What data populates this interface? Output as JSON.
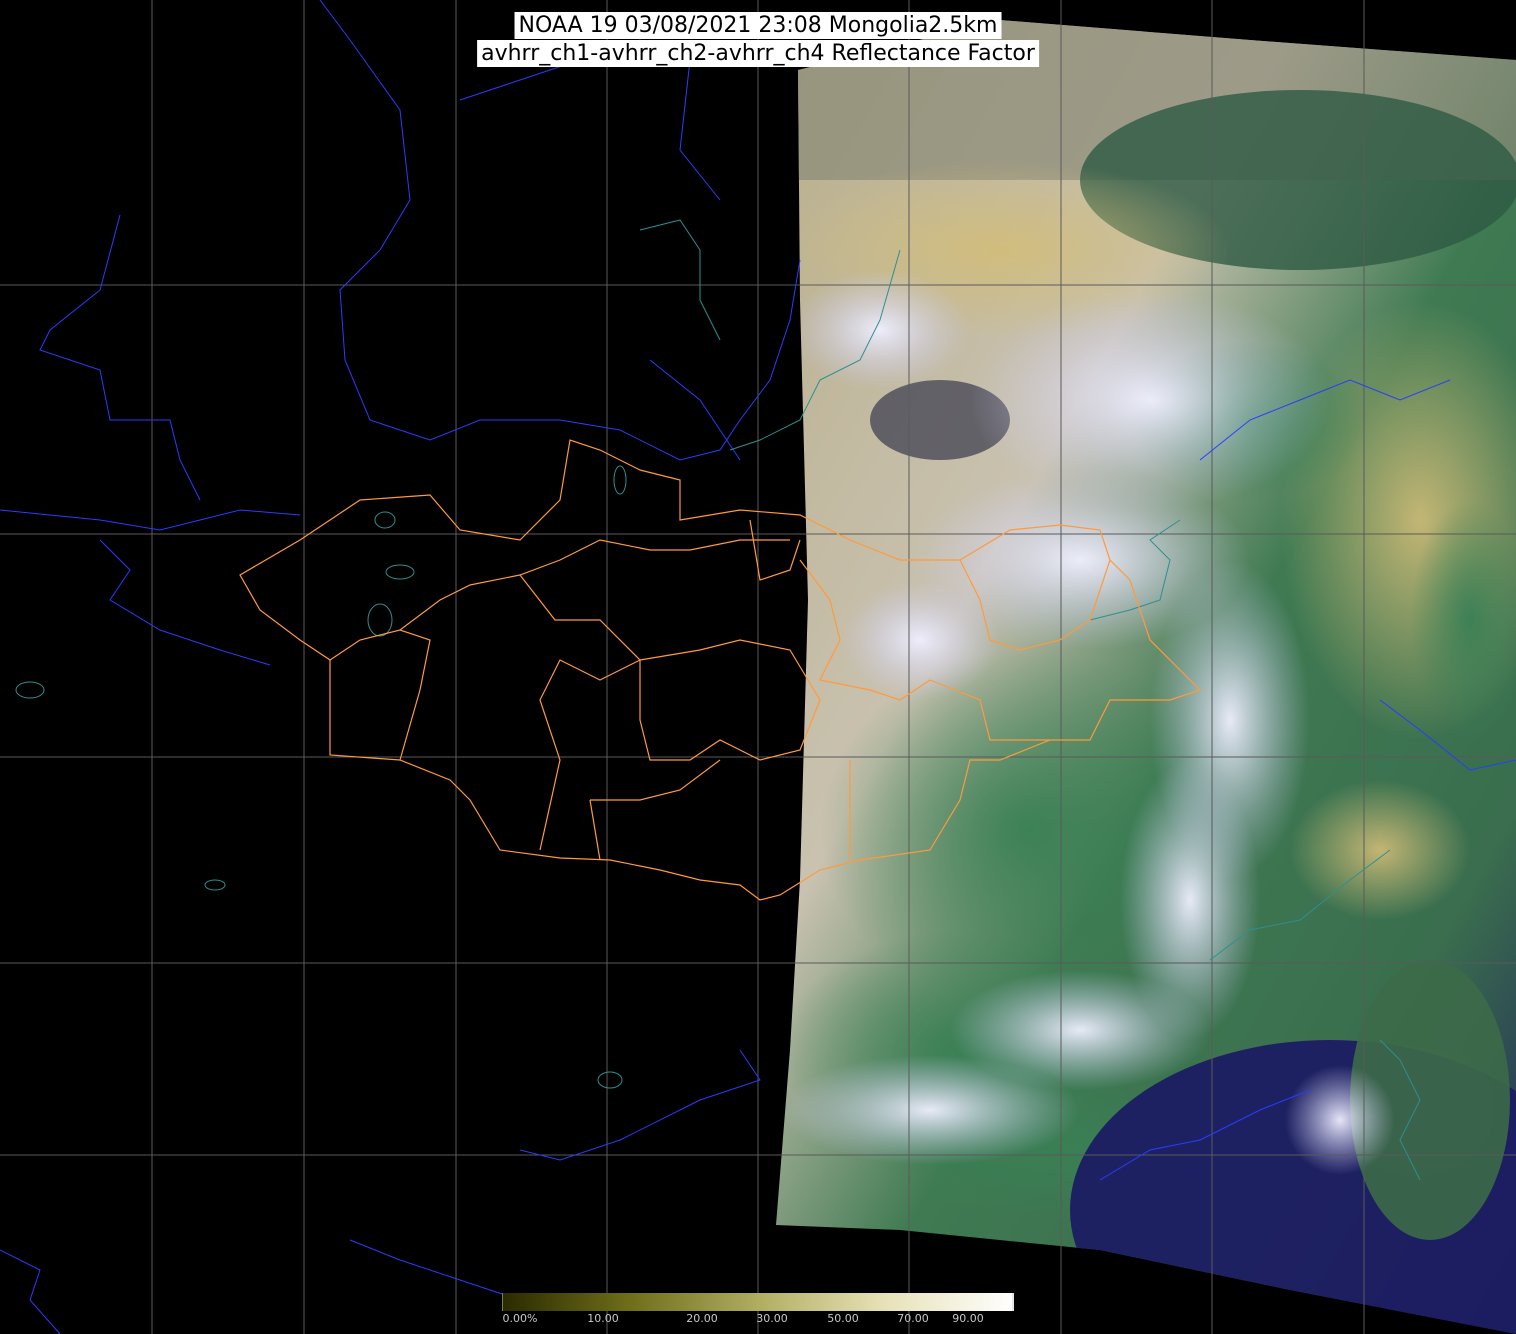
{
  "title": {
    "line1": "NOAA 19 03/08/2021 23:08 Mongolia2.5km",
    "line2": "avhrr_ch1-avhrr_ch2-avhrr_ch4 Reflectance Factor"
  },
  "colorbar": {
    "labels": [
      "0.00%",
      "10.00",
      "20.00",
      "30.00",
      "50.00",
      "70.00",
      "90.00"
    ],
    "color_low": "#2a2a00",
    "color_mid": "#c8c87a",
    "color_high": "#ffffff"
  },
  "colors": {
    "background": "#000000",
    "grid": "#5a5a5a",
    "country_border": "#2a3cff",
    "province_border": "#ff9a3c",
    "coastline": "#2f8f8f",
    "cloud": "#e6e6ff",
    "land_green": "#3c7a4a",
    "ocean_dark": "#1a1a5a",
    "sand": "#c8b67a"
  },
  "icons": {
    "satellite_swath": "satellite-image-swath",
    "grid": "lat-lon-grid"
  }
}
